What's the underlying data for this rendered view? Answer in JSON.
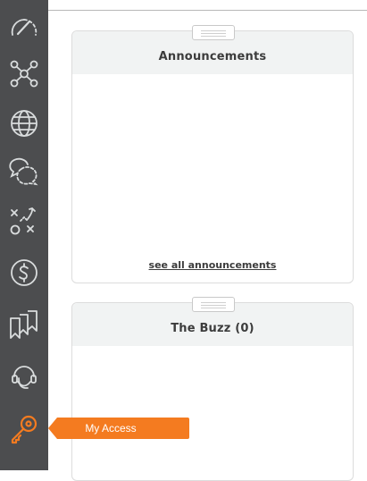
{
  "sidebar": {
    "items": [
      {
        "icon": "speedometer-icon"
      },
      {
        "icon": "network-nodes-icon"
      },
      {
        "icon": "globe-icon"
      },
      {
        "icon": "chat-bubbles-icon"
      },
      {
        "icon": "strategy-play-icon"
      },
      {
        "icon": "dollar-circle-icon"
      },
      {
        "icon": "bookmarks-icon"
      },
      {
        "icon": "headset-support-icon"
      },
      {
        "icon": "key-icon"
      }
    ],
    "active_item_color": "#f47b20",
    "icon_color": "#d9dcdd",
    "background": "#4c4d4f"
  },
  "tooltip": {
    "label": "My Access",
    "color": "#f47b20"
  },
  "announcements": {
    "title": "Announcements",
    "see_all_label": "see all announcements"
  },
  "buzz": {
    "title": "The Buzz (0)"
  }
}
